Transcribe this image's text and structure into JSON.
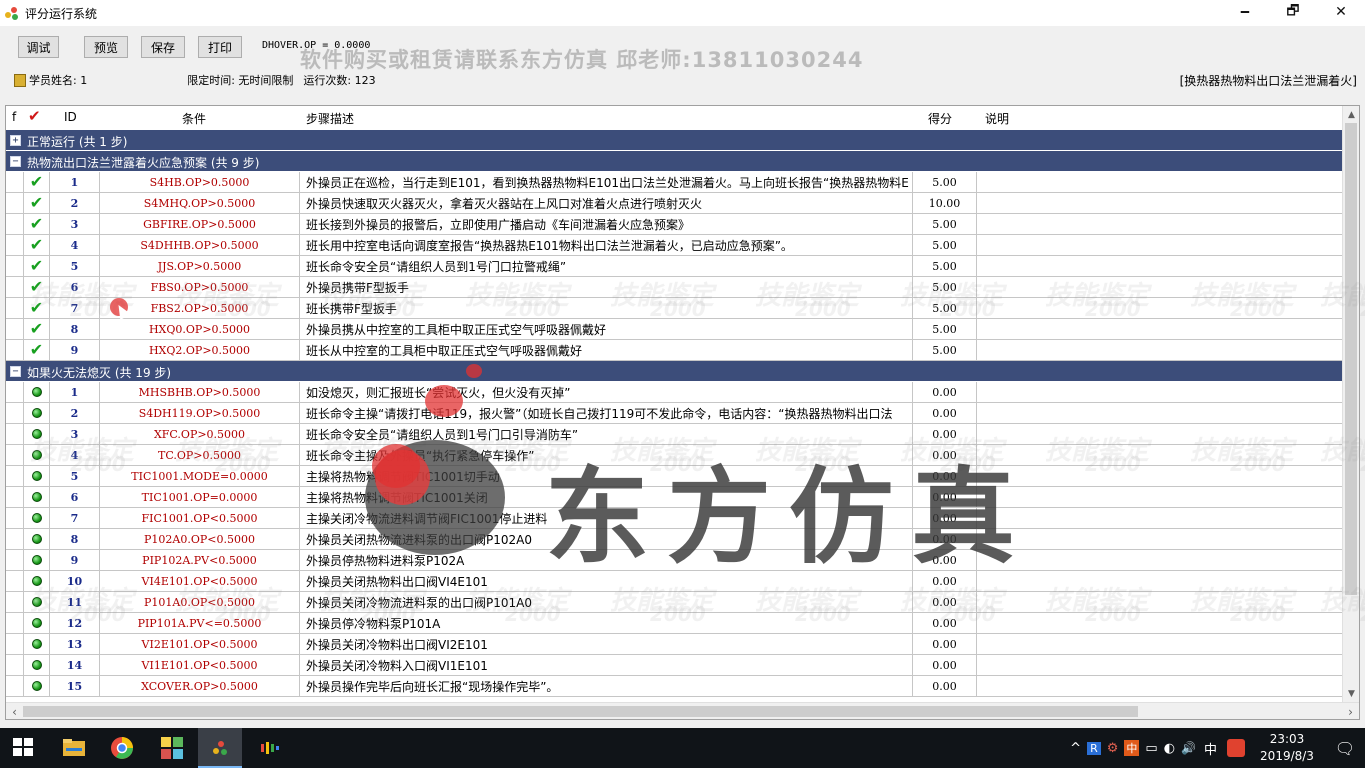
{
  "window": {
    "title": "评分运行系统",
    "minimize": "🗕",
    "restore": "🗗",
    "close": "✕"
  },
  "toolbar": {
    "debug": "调试",
    "preview": "预览",
    "save": "保存",
    "print": "打印",
    "dhover": "DHOVER.OP = 0.0000",
    "promo": "软件购买或租赁请联系东方仿真  邱老师:13811030244"
  },
  "info": {
    "student_label": "学员姓名: 1",
    "time_limit": "限定时间: 无时间限制",
    "run_count": "运行次数: 123",
    "scenario": "[换热器热物料出口法兰泄漏着火]"
  },
  "grid": {
    "headers": {
      "f": "f",
      "id": "ID",
      "cond": "条件",
      "desc": "步骤描述",
      "score": "得分",
      "note": "说明"
    },
    "groups": [
      {
        "expander": "+",
        "title": "正常运行 (共 1 步)",
        "steps": []
      },
      {
        "expander": "−",
        "title": "热物流出口法兰泄露着火应急预案 (共 9 步)",
        "steps": [
          {
            "status": "done",
            "id": "1",
            "cond": "S4HB.OP>0.5000",
            "desc": "外操员正在巡检，当行走到E101，看到换热器热物料E101出口法兰处泄漏着火。马上向班长报告“换热器热物料E",
            "score": "5.00"
          },
          {
            "status": "done",
            "id": "2",
            "cond": "S4MHQ.OP>0.5000",
            "desc": "外操员快速取灭火器灭火，拿着灭火器站在上风口对准着火点进行喷射灭火",
            "score": "10.00"
          },
          {
            "status": "done",
            "id": "3",
            "cond": "GBFIRE.OP>0.5000",
            "desc": "班长接到外操员的报警后，立即使用广播启动《车间泄漏着火应急预案》",
            "score": "5.00"
          },
          {
            "status": "done",
            "id": "4",
            "cond": "S4DHHB.OP>0.5000",
            "desc": "班长用中控室电话向调度室报告“换热器热E101物料出口法兰泄漏着火，已启动应急预案”。",
            "score": "5.00"
          },
          {
            "status": "done",
            "id": "5",
            "cond": "JJS.OP>0.5000",
            "desc": "班长命令安全员“请组织人员到1号门口拉警戒绳”",
            "score": "5.00"
          },
          {
            "status": "done",
            "id": "6",
            "cond": "FBS0.OP>0.5000",
            "desc": "外操员携带F型扳手",
            "score": "5.00"
          },
          {
            "status": "done",
            "id": "7",
            "cond": "FBS2.OP>0.5000",
            "desc": "班长携带F型扳手",
            "score": "5.00"
          },
          {
            "status": "done",
            "id": "8",
            "cond": "HXQ0.OP>0.5000",
            "desc": "外操员携从中控室的工具柜中取正压式空气呼吸器佩戴好",
            "score": "5.00"
          },
          {
            "status": "done",
            "id": "9",
            "cond": "HXQ2.OP>0.5000",
            "desc": "班长从中控室的工具柜中取正压式空气呼吸器佩戴好",
            "score": "5.00"
          }
        ]
      },
      {
        "expander": "−",
        "title": "如果火无法熄灭 (共 19 步)",
        "steps": [
          {
            "status": "pending",
            "id": "1",
            "cond": "MHSBHB.OP>0.5000",
            "desc": "如没熄灭，则汇报班长“尝试灭火，但火没有灭掉”",
            "score": "0.00"
          },
          {
            "status": "pending",
            "id": "2",
            "cond": "S4DH119.OP>0.5000",
            "desc": "班长命令主操“请拨打电话119，报火警”（如班长自己拨打119可不发此命令，电话内容：“换热器热物料出口法",
            "score": "0.00"
          },
          {
            "status": "pending",
            "id": "3",
            "cond": "XFC.OP>0.5000",
            "desc": "班长命令安全员“请组织人员到1号门口引导消防车”",
            "score": "0.00"
          },
          {
            "status": "pending",
            "id": "4",
            "cond": "TC.OP>0.5000",
            "desc": "班长命令主操及外操员“执行紧急停车操作”",
            "score": "0.00"
          },
          {
            "status": "pending",
            "id": "5",
            "cond": "TIC1001.MODE=0.0000",
            "desc": "主操将热物料调节阀TIC1001切手动",
            "score": "0.00"
          },
          {
            "status": "pending",
            "id": "6",
            "cond": "TIC1001.OP=0.0000",
            "desc": "主操将热物料调节阀TIC1001关闭",
            "score": "0.00"
          },
          {
            "status": "pending",
            "id": "7",
            "cond": "FIC1001.OP<0.5000",
            "desc": "主操关闭冷物流进料调节阀FIC1001停止进料",
            "score": "0.00"
          },
          {
            "status": "pending",
            "id": "8",
            "cond": "P102A0.OP<0.5000",
            "desc": "外操员关闭热物流进料泵的出口阀P102A0",
            "score": "0.00"
          },
          {
            "status": "pending",
            "id": "9",
            "cond": "PIP102A.PV<0.5000",
            "desc": "外操员停热物料进料泵P102A",
            "score": "0.00"
          },
          {
            "status": "pending",
            "id": "10",
            "cond": "VI4E101.OP<0.5000",
            "desc": "外操员关闭热物料出口阀VI4E101",
            "score": "0.00"
          },
          {
            "status": "pending",
            "id": "11",
            "cond": "P101A0.OP<0.5000",
            "desc": "外操员关闭冷物流进料泵的出口阀P101A0",
            "score": "0.00"
          },
          {
            "status": "pending",
            "id": "12",
            "cond": "PIP101A.PV<=0.5000",
            "desc": "外操员停冷物料泵P101A",
            "score": "0.00"
          },
          {
            "status": "pending",
            "id": "13",
            "cond": "VI2E101.OP<0.5000",
            "desc": "外操员关闭冷物料出口阀VI2E101",
            "score": "0.00"
          },
          {
            "status": "pending",
            "id": "14",
            "cond": "VI1E101.OP<0.5000",
            "desc": "外操员关闭冷物料入口阀VI1E101",
            "score": "0.00"
          },
          {
            "status": "pending",
            "id": "15",
            "cond": "XCOVER.OP>0.5000",
            "desc": "外操员操作完毕后向班长汇报“现场操作完毕”。",
            "score": "0.00"
          }
        ]
      }
    ]
  },
  "watermark": {
    "text": "技能鉴定",
    "sub": "2000",
    "logo_text": "东方仿真"
  },
  "taskbar": {
    "clock_time": "23:03",
    "clock_date": "2019/8/3",
    "ime": "中",
    "tray_glyphs": [
      "^",
      "R",
      "⚙",
      "中",
      "▭",
      "◐",
      "🔊"
    ],
    "accent": "#3c4d7a"
  }
}
